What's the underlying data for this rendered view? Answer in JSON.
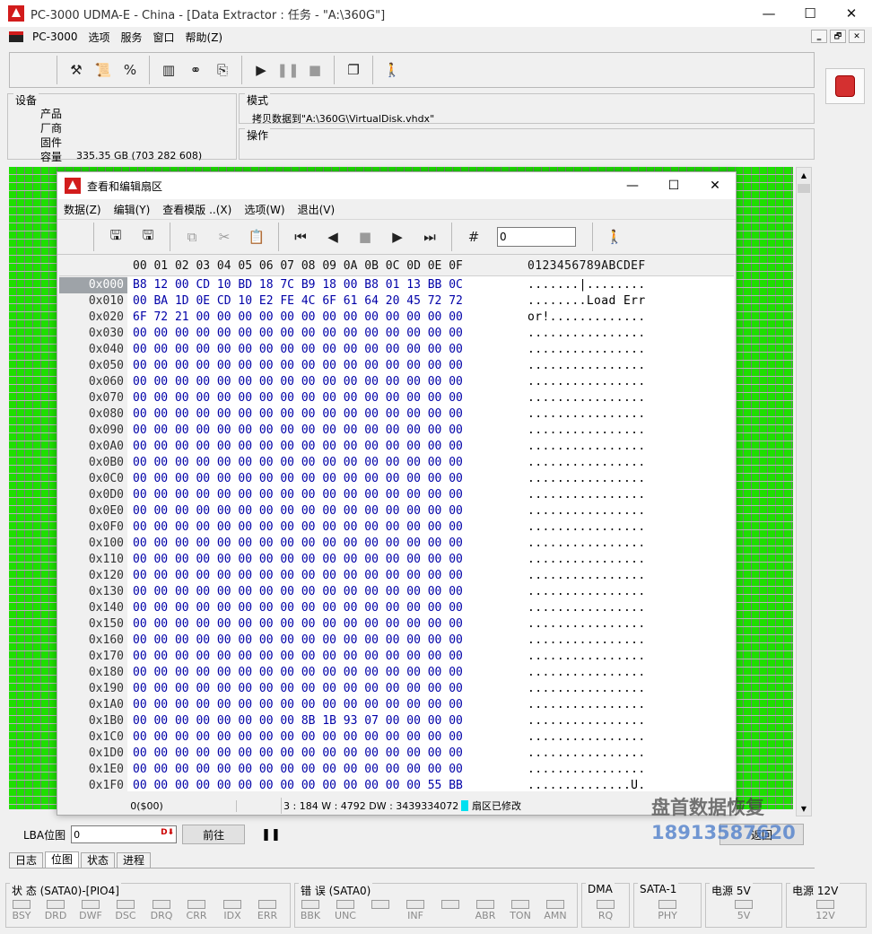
{
  "window": {
    "title": "PC-3000 UDMA-E - China - [Data Extractor : 任务 - \"A:\\360G\"]",
    "min": "—",
    "max": "☐",
    "close": "✕"
  },
  "menu": [
    "PC-3000",
    "选项",
    "服务",
    "窗口",
    "帮助(Z)"
  ],
  "mdi_controls": [
    "‗",
    "🗗",
    "✕"
  ],
  "device": {
    "title": "设备",
    "labels": [
      "产品",
      "厂商",
      "固件",
      "容量"
    ],
    "capacity": "335.35 GB (703 282 608)"
  },
  "mode": {
    "title": "模式",
    "text": "拷贝数据到\"A:\\360G\\VirtualDisk.vhdx\""
  },
  "operation": {
    "title": "操作"
  },
  "dialog": {
    "title": "查看和编辑扇区",
    "menu": [
      "数据(Z)",
      "编辑(Y)",
      "查看模版 ..(X)",
      "选项(W)",
      "退出(V)"
    ],
    "offset_value": "0",
    "hex_columns": "00 01 02 03 04 05 06 07 08 09 0A 0B 0C 0D 0E 0F",
    "ascii_header": "0123456789ABCDEF",
    "rows": [
      {
        "addr": "0x000",
        "bytes": "B8 12 00 CD 10 BD 18 7C B9 18 00 B8 01 13 BB 0C",
        "ascii": ".......|........"
      },
      {
        "addr": "0x010",
        "bytes": "00 BA 1D 0E CD 10 E2 FE 4C 6F 61 64 20 45 72 72",
        "ascii": "........Load Err"
      },
      {
        "addr": "0x020",
        "bytes": "6F 72 21 00 00 00 00 00 00 00 00 00 00 00 00 00",
        "ascii": "or!............."
      },
      {
        "addr": "0x030",
        "bytes": "00 00 00 00 00 00 00 00 00 00 00 00 00 00 00 00",
        "ascii": "................"
      },
      {
        "addr": "0x040",
        "bytes": "00 00 00 00 00 00 00 00 00 00 00 00 00 00 00 00",
        "ascii": "................"
      },
      {
        "addr": "0x050",
        "bytes": "00 00 00 00 00 00 00 00 00 00 00 00 00 00 00 00",
        "ascii": "................"
      },
      {
        "addr": "0x060",
        "bytes": "00 00 00 00 00 00 00 00 00 00 00 00 00 00 00 00",
        "ascii": "................"
      },
      {
        "addr": "0x070",
        "bytes": "00 00 00 00 00 00 00 00 00 00 00 00 00 00 00 00",
        "ascii": "................"
      },
      {
        "addr": "0x080",
        "bytes": "00 00 00 00 00 00 00 00 00 00 00 00 00 00 00 00",
        "ascii": "................"
      },
      {
        "addr": "0x090",
        "bytes": "00 00 00 00 00 00 00 00 00 00 00 00 00 00 00 00",
        "ascii": "................"
      },
      {
        "addr": "0x0A0",
        "bytes": "00 00 00 00 00 00 00 00 00 00 00 00 00 00 00 00",
        "ascii": "................"
      },
      {
        "addr": "0x0B0",
        "bytes": "00 00 00 00 00 00 00 00 00 00 00 00 00 00 00 00",
        "ascii": "................"
      },
      {
        "addr": "0x0C0",
        "bytes": "00 00 00 00 00 00 00 00 00 00 00 00 00 00 00 00",
        "ascii": "................"
      },
      {
        "addr": "0x0D0",
        "bytes": "00 00 00 00 00 00 00 00 00 00 00 00 00 00 00 00",
        "ascii": "................"
      },
      {
        "addr": "0x0E0",
        "bytes": "00 00 00 00 00 00 00 00 00 00 00 00 00 00 00 00",
        "ascii": "................"
      },
      {
        "addr": "0x0F0",
        "bytes": "00 00 00 00 00 00 00 00 00 00 00 00 00 00 00 00",
        "ascii": "................"
      },
      {
        "addr": "0x100",
        "bytes": "00 00 00 00 00 00 00 00 00 00 00 00 00 00 00 00",
        "ascii": "................"
      },
      {
        "addr": "0x110",
        "bytes": "00 00 00 00 00 00 00 00 00 00 00 00 00 00 00 00",
        "ascii": "................"
      },
      {
        "addr": "0x120",
        "bytes": "00 00 00 00 00 00 00 00 00 00 00 00 00 00 00 00",
        "ascii": "................"
      },
      {
        "addr": "0x130",
        "bytes": "00 00 00 00 00 00 00 00 00 00 00 00 00 00 00 00",
        "ascii": "................"
      },
      {
        "addr": "0x140",
        "bytes": "00 00 00 00 00 00 00 00 00 00 00 00 00 00 00 00",
        "ascii": "................"
      },
      {
        "addr": "0x150",
        "bytes": "00 00 00 00 00 00 00 00 00 00 00 00 00 00 00 00",
        "ascii": "................"
      },
      {
        "addr": "0x160",
        "bytes": "00 00 00 00 00 00 00 00 00 00 00 00 00 00 00 00",
        "ascii": "................"
      },
      {
        "addr": "0x170",
        "bytes": "00 00 00 00 00 00 00 00 00 00 00 00 00 00 00 00",
        "ascii": "................"
      },
      {
        "addr": "0x180",
        "bytes": "00 00 00 00 00 00 00 00 00 00 00 00 00 00 00 00",
        "ascii": "................"
      },
      {
        "addr": "0x190",
        "bytes": "00 00 00 00 00 00 00 00 00 00 00 00 00 00 00 00",
        "ascii": "................"
      },
      {
        "addr": "0x1A0",
        "bytes": "00 00 00 00 00 00 00 00 00 00 00 00 00 00 00 00",
        "ascii": "................"
      },
      {
        "addr": "0x1B0",
        "bytes": "00 00 00 00 00 00 00 00 8B 1B 93 07 00 00 00 00",
        "ascii": "................"
      },
      {
        "addr": "0x1C0",
        "bytes": "00 00 00 00 00 00 00 00 00 00 00 00 00 00 00 00",
        "ascii": "................"
      },
      {
        "addr": "0x1D0",
        "bytes": "00 00 00 00 00 00 00 00 00 00 00 00 00 00 00 00",
        "ascii": "................"
      },
      {
        "addr": "0x1E0",
        "bytes": "00 00 00 00 00 00 00 00 00 00 00 00 00 00 00 00",
        "ascii": "................"
      },
      {
        "addr": "0x1F0",
        "bytes": "00 00 00 00 00 00 00 00 00 00 00 00 00 00 55 BB",
        "ascii": "..............U."
      }
    ],
    "status_pos": "0($00)",
    "status_info": "3 : 184 W : 4792 DW : 3439334072",
    "status_modified": "扇区已修改"
  },
  "lba": {
    "label": "LBA位图",
    "value": "0",
    "goto": "前往",
    "pause": "❚❚",
    "right_button": "返回"
  },
  "tabs": [
    "日志",
    "位图",
    "状态",
    "进程"
  ],
  "active_tab": "位图",
  "status_groups": [
    {
      "title": "状 态 (SATA0)-[PIO4]",
      "items": [
        "BSY",
        "DRD",
        "DWF",
        "DSC",
        "DRQ",
        "CRR",
        "IDX",
        "ERR"
      ]
    },
    {
      "title": "错 误 (SATA0)",
      "items": [
        "BBK",
        "UNC",
        "",
        "INF",
        "",
        "ABR",
        "TON",
        "AMN"
      ]
    },
    {
      "title": "DMA",
      "items": [
        "RQ"
      ]
    },
    {
      "title": "SATA-1",
      "items": [
        "PHY"
      ]
    },
    {
      "title": "电源 5V",
      "items": [
        "5V"
      ]
    },
    {
      "title": "电源 12V",
      "items": [
        "12V"
      ]
    }
  ],
  "watermark": {
    "line1": "盘首数据恢复",
    "line2": "18913587620"
  }
}
